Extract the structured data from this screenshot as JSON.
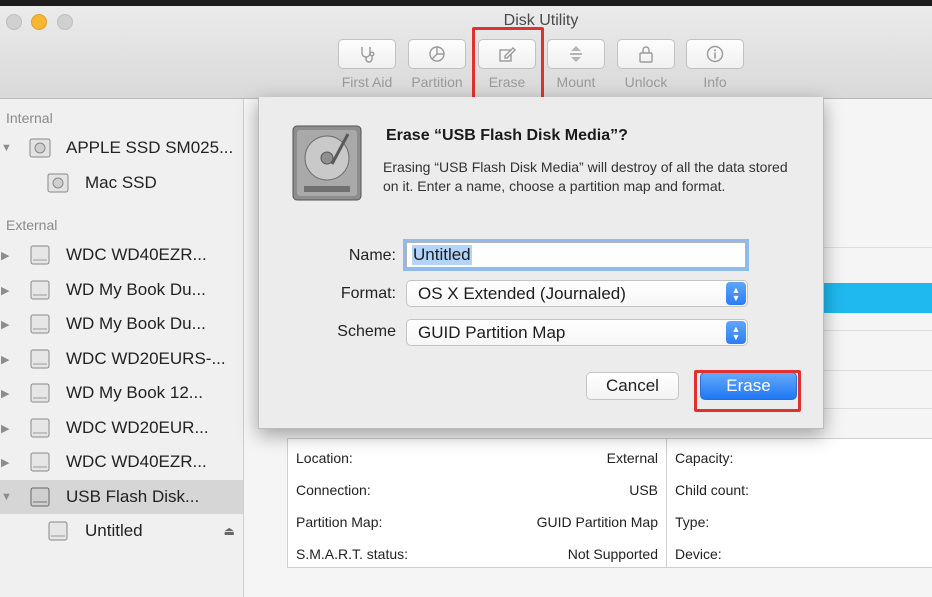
{
  "window": {
    "title": "Disk Utility"
  },
  "toolbar": {
    "first_aid": "First Aid",
    "partition": "Partition",
    "erase": "Erase",
    "mount": "Mount",
    "unlock": "Unlock",
    "info": "Info"
  },
  "sidebar": {
    "internal_header": "Internal",
    "external_header": "External",
    "internal_items": [
      {
        "label": "APPLE SSD SM025..."
      },
      {
        "label": "Mac SSD"
      }
    ],
    "external_items": [
      {
        "label": "WDC WD40EZR..."
      },
      {
        "label": "WD My Book Du..."
      },
      {
        "label": "WD My Book Du..."
      },
      {
        "label": "WDC WD20EURS-..."
      },
      {
        "label": "WD My Book 12..."
      },
      {
        "label": "WDC WD20EUR..."
      },
      {
        "label": "WDC WD40EZR..."
      },
      {
        "label": "USB Flash Disk..."
      },
      {
        "label": "Untitled"
      }
    ],
    "eject_glyph": "⏏"
  },
  "dialog": {
    "title": "Erase “USB Flash Disk Media”?",
    "message": "Erasing “USB Flash Disk Media” will destroy of all the data stored on it. Enter a name, choose a partition map and format.",
    "name_label": "Name:",
    "name_value": "Untitled",
    "format_label": "Format:",
    "format_value": "OS X Extended (Journaled)",
    "scheme_label": "Scheme",
    "scheme_value": "GUID Partition Map",
    "cancel_label": "Cancel",
    "erase_label": "Erase"
  },
  "info": {
    "rows": [
      {
        "key": "Location:",
        "value": "External",
        "key2": "Capacity:"
      },
      {
        "key": "Connection:",
        "value": "USB",
        "key2": "Child count:"
      },
      {
        "key": "Partition Map:",
        "value": "GUID Partition Map",
        "key2": "Type:"
      },
      {
        "key": "S.M.A.R.T. status:",
        "value": "Not Supported",
        "key2": "Device:"
      }
    ]
  },
  "colors": {
    "accent_blue": "#1f77f3",
    "highlight_red": "#e03131",
    "selection_strip": "#1fb8ef"
  }
}
